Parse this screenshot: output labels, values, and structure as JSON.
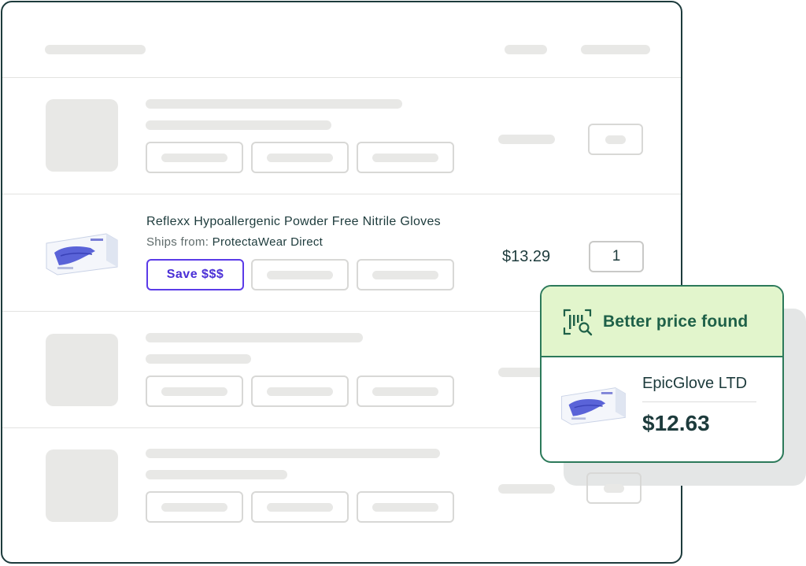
{
  "featured_row": {
    "product_title": "Reflexx Hypoallergenic Powder Free Nitrile Gloves",
    "ships_label": "Ships from:",
    "ships_from": "ProtectaWear Direct",
    "save_button": "Save $$$",
    "price": "$13.29",
    "quantity": "1",
    "product_image": "glove-box-image"
  },
  "better_price_card": {
    "icon": "barcode-search-icon",
    "heading": "Better price found",
    "seller": "EpicGlove LTD",
    "price": "$12.63",
    "product_image": "glove-box-image"
  },
  "colors": {
    "outline": "#1d3b3c",
    "save_accent": "#5b3be8",
    "card_border": "#2c7a5a",
    "card_header_bg": "#e2f5cc",
    "skeleton": "#e8e8e6"
  }
}
